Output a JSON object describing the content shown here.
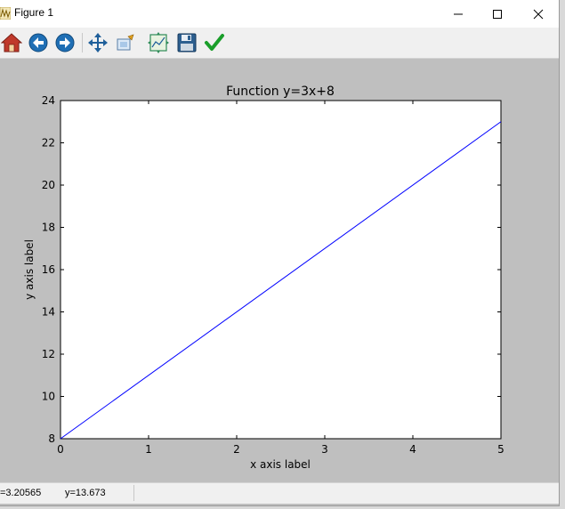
{
  "window": {
    "title": "Figure 1"
  },
  "toolbar": {
    "buttons": [
      {
        "name": "home",
        "icon": "home-icon"
      },
      {
        "name": "back",
        "icon": "back-arrow-icon"
      },
      {
        "name": "forward",
        "icon": "forward-arrow-icon"
      },
      {
        "name": "pan",
        "icon": "pan-move-icon"
      },
      {
        "name": "zoom",
        "icon": "zoom-rect-icon"
      },
      {
        "name": "configure-subplots",
        "icon": "subplots-icon"
      },
      {
        "name": "save",
        "icon": "save-floppy-icon"
      },
      {
        "name": "edit-parameters",
        "icon": "checkmark-icon"
      }
    ]
  },
  "status": {
    "x": "=3.20565",
    "y": "y=13.673"
  },
  "colors": {
    "line": "#0000ff",
    "figure_bg": "#bfbfbf",
    "axes_bg": "#ffffff"
  },
  "chart_data": {
    "type": "line",
    "title": "Function y=3x+8",
    "xlabel": "x axis label",
    "ylabel": "y axis label",
    "xlim": [
      0,
      5
    ],
    "ylim": [
      8,
      24
    ],
    "xticks": [
      "0",
      "1",
      "2",
      "3",
      "4",
      "5"
    ],
    "yticks": [
      "8",
      "10",
      "12",
      "14",
      "16",
      "18",
      "20",
      "22",
      "24"
    ],
    "series": [
      {
        "x": [
          0,
          5
        ],
        "y": [
          8,
          23
        ]
      }
    ],
    "grid": false
  }
}
